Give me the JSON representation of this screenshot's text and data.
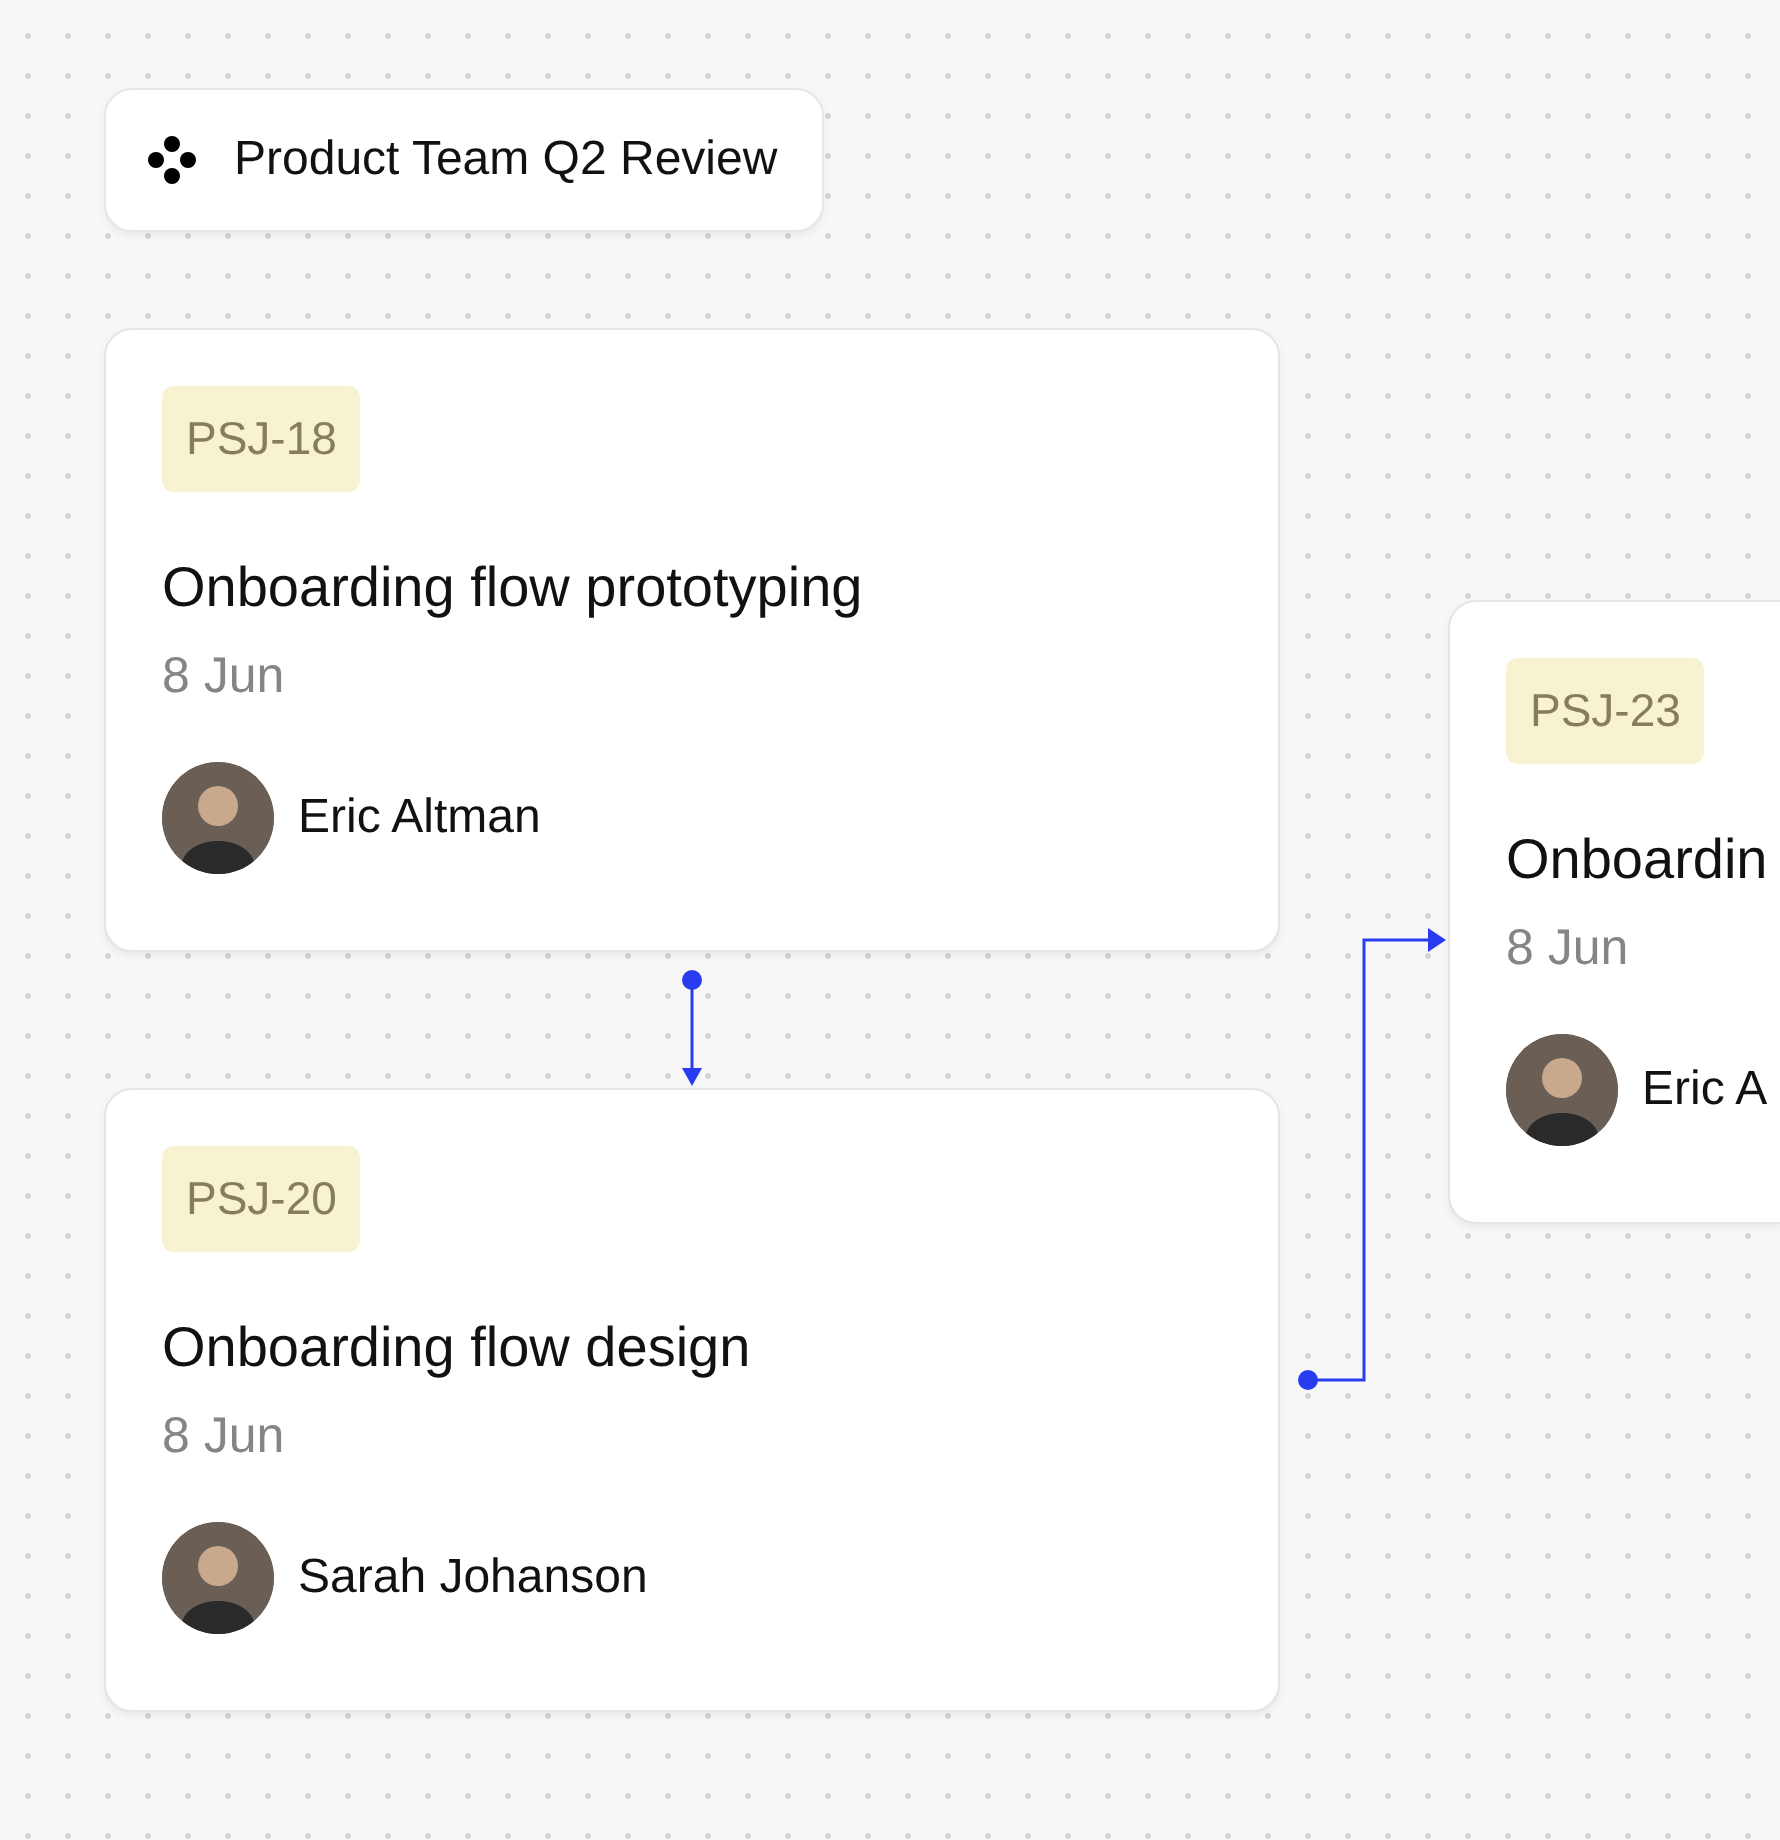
{
  "board": {
    "title": "Product Team Q2 Review"
  },
  "cards": [
    {
      "tag": "PSJ-18",
      "title": "Onboarding flow prototyping",
      "date": "8 Jun",
      "assignee": "Eric Altman",
      "cut": false
    },
    {
      "tag": "PSJ-20",
      "title": "Onboarding flow design",
      "date": "8 Jun",
      "assignee": "Sarah Johanson",
      "cut": false
    },
    {
      "tag": "PSJ-23",
      "title": "Onboardin",
      "date": "8 Jun",
      "assignee": "Eric A",
      "cut": true
    }
  ]
}
